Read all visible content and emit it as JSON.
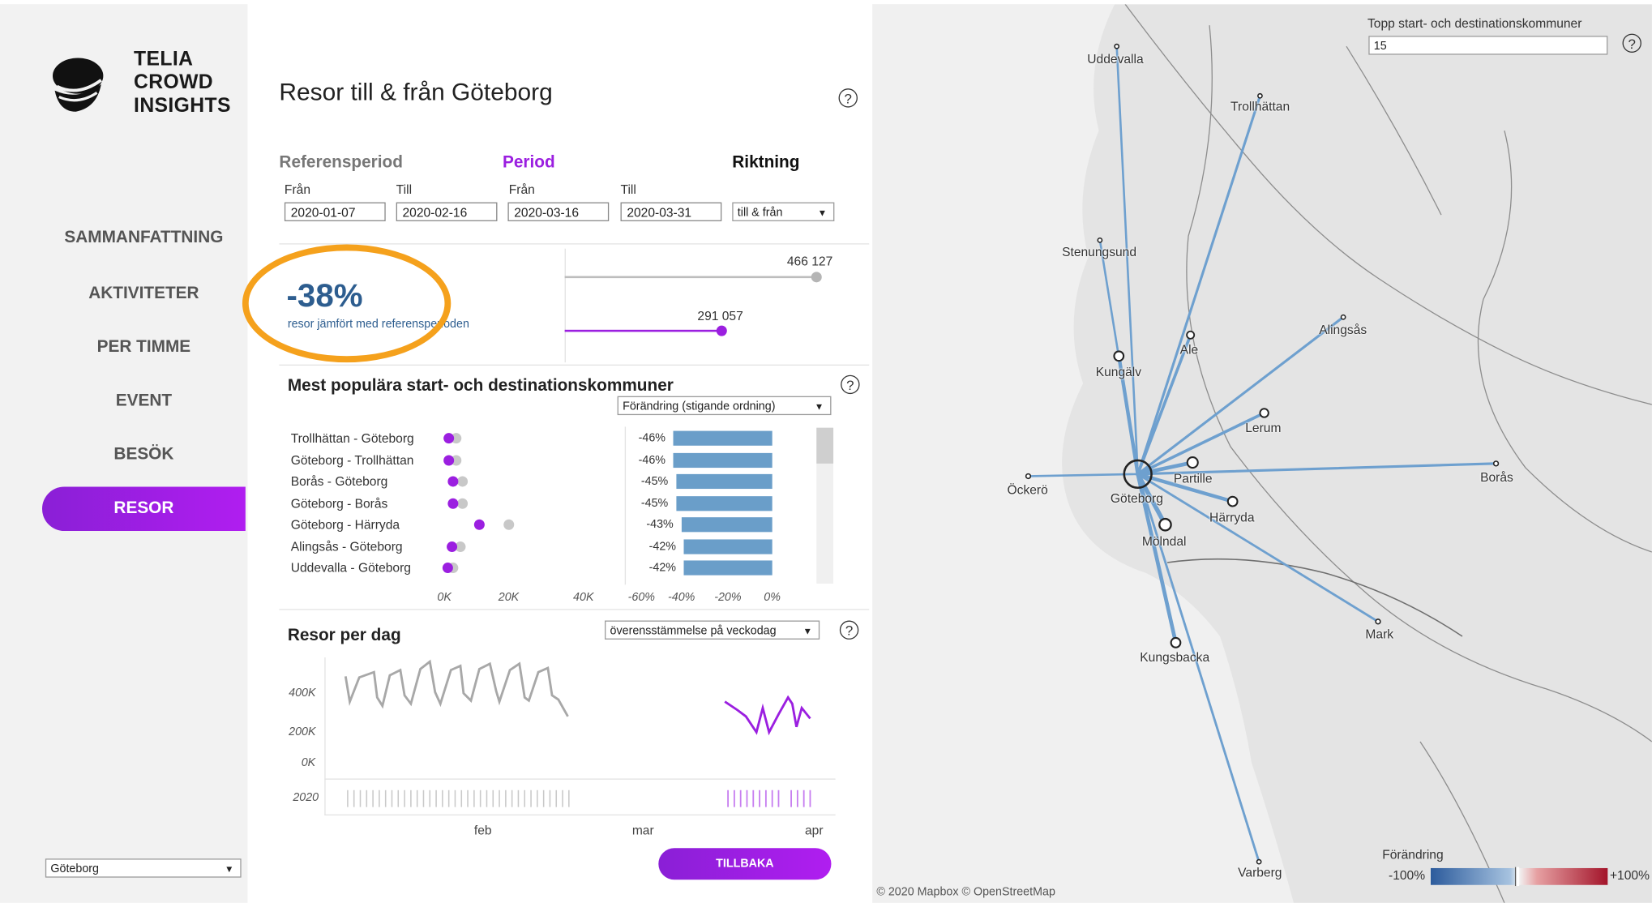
{
  "brand": {
    "line1": "TELIA",
    "line2": "CROWD",
    "line3": "INSIGHTS"
  },
  "nav": {
    "items": [
      {
        "label": "SAMMANFATTNING"
      },
      {
        "label": "AKTIVITETER"
      },
      {
        "label": "PER TIMME"
      },
      {
        "label": "EVENT"
      },
      {
        "label": "BESÖK"
      },
      {
        "label": "RESOR",
        "active": true
      }
    ]
  },
  "region_select": {
    "value": "Göteborg"
  },
  "page": {
    "title": "Resor till & från Göteborg"
  },
  "filters": {
    "reference_title": "Referensperiod",
    "period_title": "Period",
    "direction_title": "Riktning",
    "from_label": "Från",
    "to_label": "Till",
    "ref_from": "2020-01-07",
    "ref_to": "2020-02-16",
    "period_from": "2020-03-16",
    "period_to": "2020-03-31",
    "direction_value": "till & från"
  },
  "kpi": {
    "value": "-38%",
    "caption": "resor jämfört med referensperioden",
    "reference_total": "466 127",
    "period_total": "291 057"
  },
  "popular": {
    "title": "Mest populära start- och destinationskommuner",
    "sort_value": "Förändring (stigande ordning)",
    "rows": [
      {
        "label": "Trollhättan - Göteborg",
        "change": "-46%",
        "change_value": -46
      },
      {
        "label": "Göteborg - Trollhättan",
        "change": "-46%",
        "change_value": -46
      },
      {
        "label": "Borås - Göteborg",
        "change": "-45%",
        "change_value": -45
      },
      {
        "label": "Göteborg - Borås",
        "change": "-45%",
        "change_value": -45
      },
      {
        "label": "Göteborg - Härryda",
        "change": "-43%",
        "change_value": -43
      },
      {
        "label": "Alingsås - Göteborg",
        "change": "-42%",
        "change_value": -42
      },
      {
        "label": "Uddevalla - Göteborg",
        "change": "-42%",
        "change_value": -42
      }
    ],
    "dot_axis_ticks": [
      "0K",
      "20K",
      "40K"
    ],
    "bar_axis_ticks": [
      "-60%",
      "-40%",
      "-20%",
      "0%"
    ]
  },
  "daily": {
    "title": "Resor per dag",
    "compare_value": "överensstämmelse på veckodag",
    "y_ticks": [
      "400K",
      "200K",
      "0K"
    ],
    "year_label": "2020",
    "x_ticks": [
      "feb",
      "mar",
      "apr"
    ],
    "back_button": "TILLBAKA"
  },
  "map": {
    "top_label": "Topp start- och destinationskommuner",
    "top_value": "15",
    "attribution": "© 2020 Mapbox © OpenStreetMap",
    "legend_title": "Förändring",
    "legend_min": "-100%",
    "legend_max": "+100%",
    "places": {
      "uddevalla": "Uddevalla",
      "trollhattan": "Trollhättan",
      "stenungsund": "Stenungsund",
      "alingsas": "Alingsås",
      "ale": "Ale",
      "kungalv": "Kungälv",
      "lerum": "Lerum",
      "ockero": "Öckerö",
      "goteborg": "Göteborg",
      "partille": "Partille",
      "boras": "Borås",
      "harryda": "Härryda",
      "molndal": "Mölndal",
      "mark": "Mark",
      "kungsbacka": "Kungsbacka",
      "varberg": "Varberg"
    }
  },
  "colors": {
    "purple": "#9b1fe0",
    "bar_blue": "#6a9ec9",
    "highlight_orange": "#f5a11c"
  }
}
